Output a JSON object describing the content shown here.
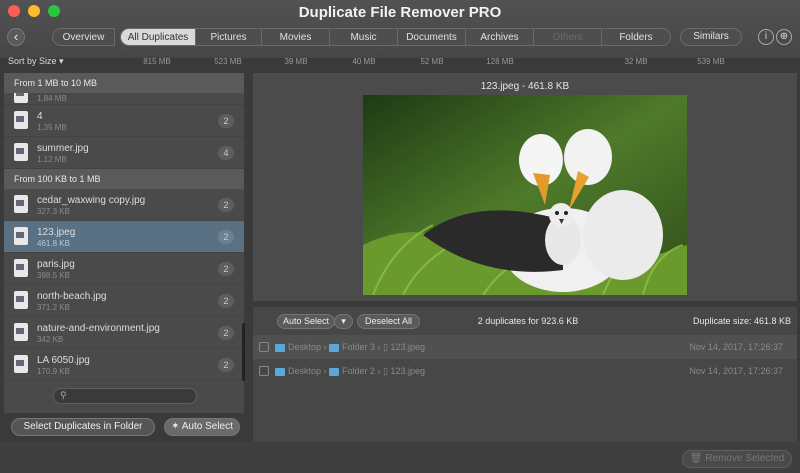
{
  "window": {
    "title": "Duplicate File Remover PRO",
    "traffic_lights": [
      "#fc5f57",
      "#fdbc2e",
      "#28c840"
    ]
  },
  "nav": {
    "back_icon": "chevron-left",
    "tabs": [
      {
        "label": "Overview",
        "size": ""
      },
      {
        "label": "All Duplicates",
        "size": "815 MB"
      },
      {
        "label": "Pictures",
        "size": "523 MB"
      },
      {
        "label": "Movies",
        "size": "39 MB"
      },
      {
        "label": "Music",
        "size": "40 MB"
      },
      {
        "label": "Documents",
        "size": "52 MB"
      },
      {
        "label": "Archives",
        "size": "128 MB"
      },
      {
        "label": "Others",
        "size": ""
      },
      {
        "label": "Folders",
        "size": "32 MB"
      }
    ],
    "similars": {
      "label": "Similars",
      "size": "539 MB"
    },
    "info_glyph": "i",
    "share_glyph": "⊕"
  },
  "sort": {
    "label": "Sort by Size",
    "caret": "▾"
  },
  "left": {
    "groups": [
      {
        "title": "From 1 MB to 10 MB",
        "files": [
          {
            "name": "",
            "size": "1.84 MB",
            "count": ""
          },
          {
            "name": "4",
            "size": "1.35 MB",
            "count": "2"
          },
          {
            "name": "summer.jpg",
            "size": "1.12 MB",
            "count": "4"
          }
        ]
      },
      {
        "title": "From 100 KB to 1 MB",
        "files": [
          {
            "name": "cedar_waxwing copy.jpg",
            "size": "327.3 KB",
            "count": "2"
          },
          {
            "name": "123.jpeg",
            "size": "461.8 KB",
            "count": "2"
          },
          {
            "name": "paris.jpg",
            "size": "398.5 KB",
            "count": "2"
          },
          {
            "name": "north-beach.jpg",
            "size": "371.2 KB",
            "count": "2"
          },
          {
            "name": "nature-and-environment.jpg",
            "size": "342 KB",
            "count": "2"
          },
          {
            "name": "LA 6050.jpg",
            "size": "170.9 KB",
            "count": "2"
          }
        ]
      }
    ],
    "search_placeholder": "",
    "select_in_folder": "Select Duplicates in Folder",
    "auto_select": "Auto Select",
    "wand_glyph": "✶"
  },
  "preview": {
    "title": "123.jpeg - 461.8 KB"
  },
  "duplicates": {
    "auto_select": "Auto Select",
    "deselect_all": "Deselect All",
    "summary": "2 duplicates for 923.6 KB",
    "duplicate_size": "Duplicate size: 461.8 KB",
    "rows": [
      {
        "path": [
          "Desktop",
          "Folder 3",
          "123.jpeg"
        ],
        "date": "Nov 14, 2017, 17:26:37"
      },
      {
        "path": [
          "Desktop",
          "Folder 2",
          "123.jpeg"
        ],
        "date": "Nov 14, 2017, 17:26:37"
      }
    ]
  },
  "footer": {
    "remove_selected": "Remove Selected"
  }
}
